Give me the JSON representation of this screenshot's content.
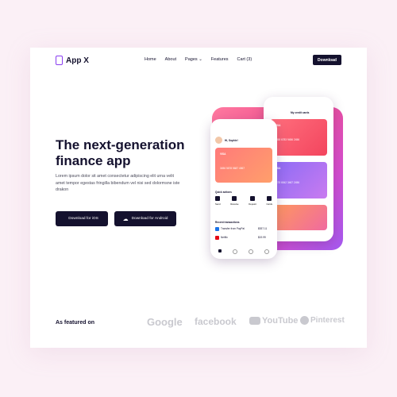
{
  "header": {
    "logo_text": "App X",
    "nav": [
      "Home",
      "About",
      "Pages",
      "Features",
      "Cart (3)"
    ],
    "download_label": "Download"
  },
  "hero": {
    "title": "The next-generation finance app",
    "subtitle": "Lorem ipsum dolor sit amet consectetur adipiscing elit urna velit amet tempor egestas fringilla bibendum vel nisi sed dolormsne iste drakon",
    "ios_label": "Download for iOS",
    "android_label": "Download for Android"
  },
  "phones": {
    "back_title": "My credit cards",
    "back_card1_brand": "VISA",
    "back_card1_number": "3458  6783  9456  2456",
    "back_card2_brand": "VISA",
    "back_card2_number": "3478  6542  3467  2456",
    "front_greeting": "Hi, Sophie!",
    "front_card_brand": "VISA",
    "front_card_number": "3456  5678  5687  4567",
    "quick_actions": "Quick actions",
    "actions": [
      "Send",
      "Receive",
      "Deposit",
      "Cards"
    ],
    "recent": "Recent transactions",
    "tx1_name": "Transfer from PayPal",
    "tx1_amount": "$537.11",
    "tx2_name": "Netflix",
    "tx2_amount": "$19.99"
  },
  "featured": {
    "label": "As featured on",
    "brands": [
      "Google",
      "facebook",
      "YouTube",
      "Pinterest"
    ]
  },
  "colors": {
    "navy": "#14112e",
    "accent": "#8a3df0",
    "background": "#fbf0f6"
  }
}
